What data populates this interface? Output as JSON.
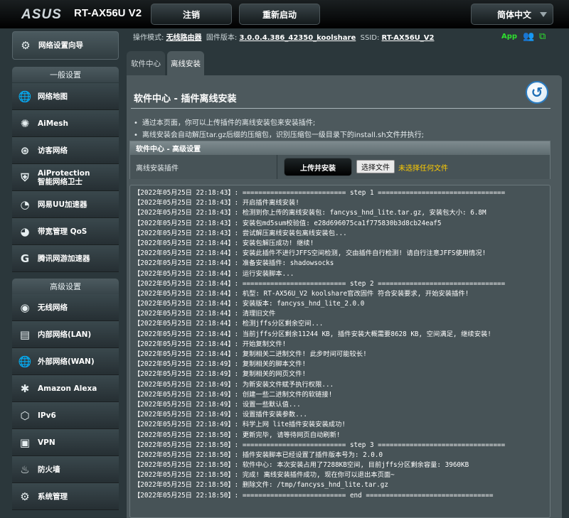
{
  "header": {
    "logo": "ASUS",
    "model": "RT-AX56U V2",
    "logout_label": "注销",
    "reboot_label": "重新启动",
    "language": "简体中文"
  },
  "info_bar": {
    "mode_label": "操作模式:",
    "mode_value": "无线路由器",
    "firmware_label": "固件版本:",
    "firmware_value": "3.0.0.4.386_42350_koolshare",
    "ssid_label": "SSID:",
    "ssid_value": "RT-AX56U_V2",
    "app_label": "App"
  },
  "sidebar": {
    "wizard": "网络设置向导",
    "general_title": "一般设置",
    "general_items": [
      {
        "label": "网络地图",
        "icon": "globe-icon"
      },
      {
        "label": "AiMesh",
        "icon": "mesh-icon"
      },
      {
        "label": "访客网络",
        "icon": "guest-network-icon"
      },
      {
        "label": "AiProtection\n智能网络卫士",
        "icon": "shield-icon"
      },
      {
        "label": "网易UU加速器",
        "icon": "speedometer-icon"
      },
      {
        "label": "带宽管理 QoS",
        "icon": "qos-gauge-icon"
      },
      {
        "label": "腾讯网游加速器",
        "icon": "game-accelerator-icon"
      }
    ],
    "advanced_title": "高级设置",
    "advanced_items": [
      {
        "label": "无线网络",
        "icon": "wireless-icon"
      },
      {
        "label": "内部网络(LAN)",
        "icon": "lan-icon"
      },
      {
        "label": "外部网络(WAN)",
        "icon": "wan-globe-icon"
      },
      {
        "label": "Amazon Alexa",
        "icon": "alexa-icon"
      },
      {
        "label": "IPv6",
        "icon": "ipv6-icon"
      },
      {
        "label": "VPN",
        "icon": "vpn-icon"
      },
      {
        "label": "防火墙",
        "icon": "firewall-icon"
      },
      {
        "label": "系统管理",
        "icon": "gear-icon"
      }
    ]
  },
  "tabs": [
    {
      "label": "软件中心"
    },
    {
      "label": "离线安装"
    }
  ],
  "main": {
    "title": "软件中心 - 插件离线安装",
    "bullets": [
      "通过本页面，你可以上传插件的离线安装包来安装插件;",
      "离线安装会自动解压tar.gz后缀的压缩包，识别压缩包一级目录下的install.sh文件并执行;"
    ],
    "advanced_title": "软件中心 - 高级设置",
    "install_label": "离线安装插件",
    "upload_button": "上传并安装",
    "choose_file_button": "选择文件",
    "file_status": "未选择任何文件"
  },
  "log_lines": [
    "【2022年05月25日 22:18:43】: ========================== step 1 ================================",
    "【2022年05月25日 22:18:43】: 开启插件离线安装!",
    "【2022年05月25日 22:18:43】: 检测到你上传的离线安装包: fancyss_hnd_lite.tar.gz, 安装包大小: 6.8M",
    "【2022年05月25日 22:18:43】: 安装包md5sum校验值: e28d696075ca1f775830b3d8cb24eaf5",
    "【2022年05月25日 22:18:43】: 尝试解压离线安装包离线安装包...",
    "【2022年05月25日 22:18:44】: 安装包解压成功! 继续!",
    "【2022年05月25日 22:18:44】: 安装此插件不进行JFFS空间检测, 交由插件自行检测! 请自行注意JFFS使用情况!",
    "【2022年05月25日 22:18:44】: 准备安装插件: shadowsocks",
    "【2022年05月25日 22:18:44】: 运行安装脚本...",
    "【2022年05月25日 22:18:44】: ========================== step 2 ================================",
    "【2022年05月25日 22:18:44】: 机型: RT-AX56U_V2 koolshare官改固件 符合安装要求, 开始安装插件!",
    "【2022年05月25日 22:18:44】: 安装版本: fancyss_hnd_lite_2.0.0",
    "【2022年05月25日 22:18:44】: 清理旧文件",
    "【2022年05月25日 22:18:44】: 检测jffs分区剩余空间...",
    "【2022年05月25日 22:18:44】: 当前jffs分区剩余11244 KB, 插件安装大概需要8628 KB, 空间满足, 继续安装!",
    "【2022年05月25日 22:18:44】: 开始复制文件!",
    "【2022年05月25日 22:18:44】: 复制相关二进制文件! 此步时间可能较长!",
    "【2022年05月25日 22:18:49】: 复制相关的脚本文件!",
    "【2022年05月25日 22:18:49】: 复制相关的网页文件!",
    "【2022年05月25日 22:18:49】: 为新安装文件赋予执行权限...",
    "【2022年05月25日 22:18:49】: 创建一些二进制文件的软链接!",
    "【2022年05月25日 22:18:49】: 设置一些默认值...",
    "【2022年05月25日 22:18:49】: 设置插件安装参数...",
    "【2022年05月25日 22:18:49】: 科学上网 lite插件安装安装成功!",
    "【2022年05月25日 22:18:50】: 更新完毕, 请等待网页自动刷新!",
    "【2022年05月25日 22:18:50】: ========================== step 3 ================================",
    "【2022年05月25日 22:18:50】: 插件安装脚本已经设置了插件版本号为: 2.0.0",
    "【2022年05月25日 22:18:50】: 软件中心: 本次安装占用了7288KB空间, 目前jffs分区剩余容量: 3960KB",
    "【2022年05月25日 22:18:50】: 完成! 离线安装插件成功, 现在你可以退出本页面~",
    "【2022年05月25日 22:18:50】: 删除文件: /tmp/fancyss_hnd_lite.tar.gz",
    "【2022年05月25日 22:18:50】: ========================== end ================================"
  ]
}
